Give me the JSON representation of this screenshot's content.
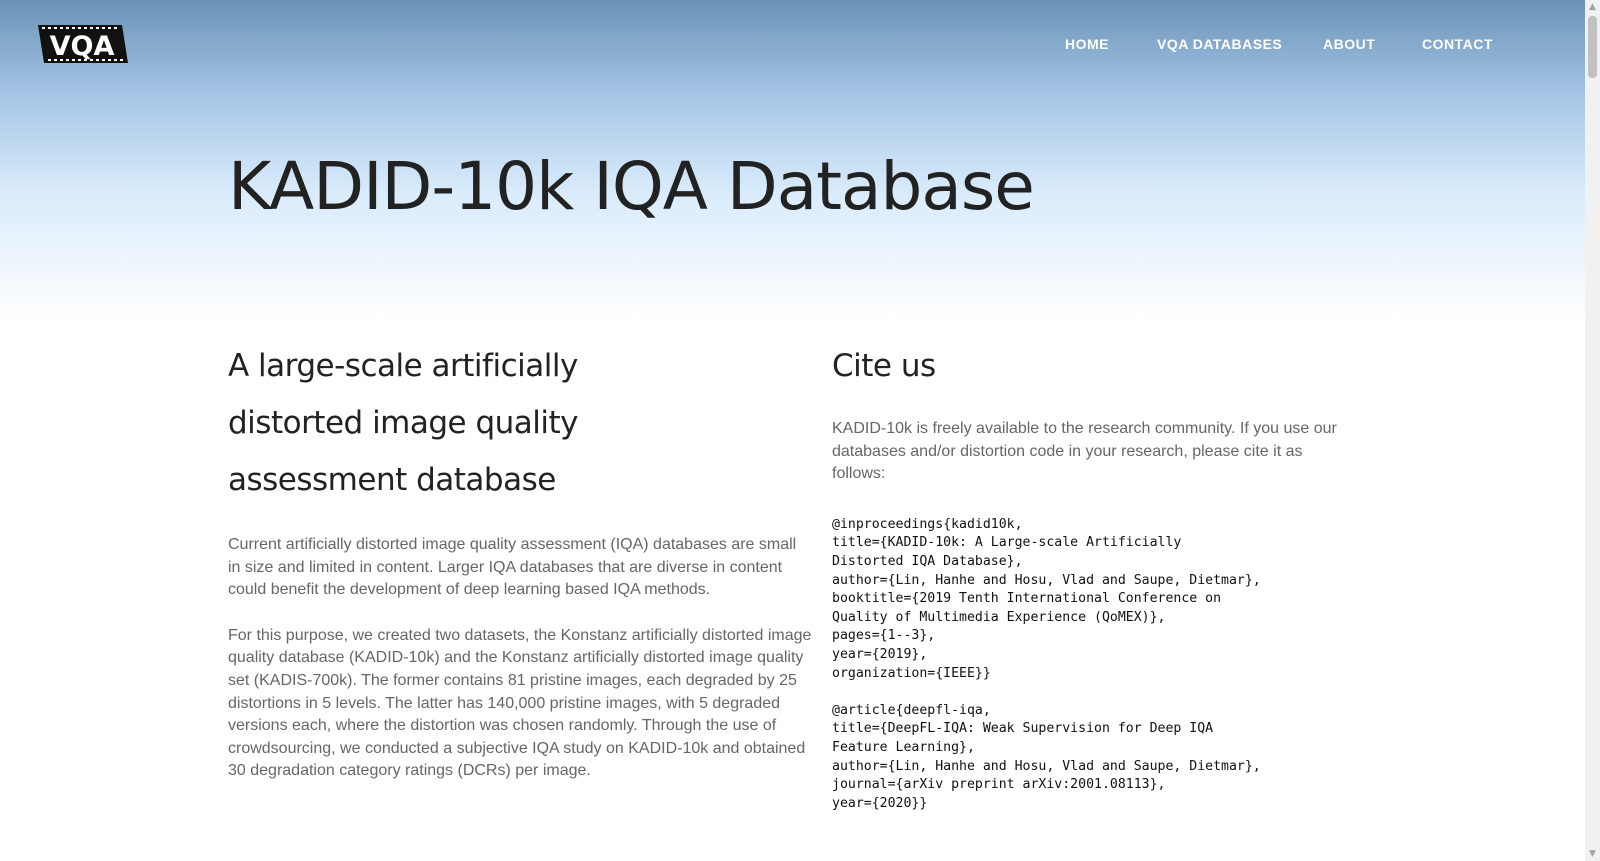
{
  "brand": {
    "logo_text": "VQA"
  },
  "nav": {
    "items": [
      {
        "label": "HOME"
      },
      {
        "label": "VQA DATABASES"
      },
      {
        "label": "ABOUT"
      },
      {
        "label": "CONTACT"
      }
    ]
  },
  "hero": {
    "title": "KADID-10k IQA Database"
  },
  "intro_section": {
    "heading": "A large-scale artificially distorted image quality assessment database",
    "paragraphs": [
      "Current artificially distorted image quality assessment (IQA) databases are small in size and limited in content. Larger IQA databases that are diverse in content could benefit the development of deep learning based IQA methods.",
      "For this purpose, we created two datasets, the Konstanz artificially distorted image quality database (KADID-10k) and the Konstanz artificially distorted image quality set (KADIS-700k). The former contains 81 pristine images, each degraded by 25 distortions in 5 levels. The latter has 140,000 pristine images, with 5 degraded versions each, where the distortion was chosen randomly. Through the use of crowdsourcing, we conducted a subjective IQA study on KADID-10k and obtained 30 degradation category ratings (DCRs) per image."
    ]
  },
  "cite_section": {
    "heading": "Cite us",
    "intro": "KADID-10k is freely available to the research community. If you use our databases and/or distortion code in your research, please cite it as follows:",
    "bibtex": [
      "@inproceedings{kadid10k,\ntitle={KADID-10k: A Large-scale Artificially\nDistorted IQA Database},\nauthor={Lin, Hanhe and Hosu, Vlad and Saupe, Dietmar},\nbooktitle={2019 Tenth International Conference on\nQuality of Multimedia Experience (QoMEX)},\npages={1--3},\nyear={2019},\norganization={IEEE}}",
      "@article{deepfl-iqa,\ntitle={DeepFL-IQA: Weak Supervision for Deep IQA\nFeature Learning},\nauthor={Lin, Hanhe and Hosu, Vlad and Saupe, Dietmar},\njournal={arXiv preprint arXiv:2001.08113},\nyear={2020}}"
    ]
  },
  "colors": {
    "hero_top": "#6a92b6",
    "hero_bottom": "#ffffff",
    "title_text": "#222222",
    "body_text": "#666666",
    "nav_text": "#ffffff"
  }
}
